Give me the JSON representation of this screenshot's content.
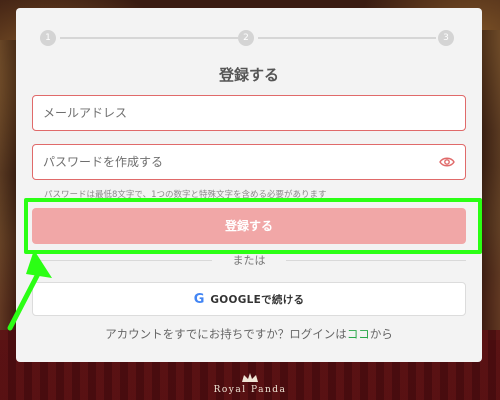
{
  "stepper": {
    "steps": [
      "1",
      "2",
      "3"
    ]
  },
  "form": {
    "title": "登録する",
    "email_placeholder": "メールアドレス",
    "password_placeholder": "パスワードを作成する",
    "password_hint": "パスワードは最低8文字で、1つの数字と特殊文字を含める必要があります",
    "register_label": "登録する",
    "or_text": "または",
    "google_icon_glyph": "G",
    "google_label": "GOOGLEで続ける",
    "login_prompt": "アカウントをすでにお持ちですか？ログインは",
    "login_link": "ココ",
    "login_suffix": "から"
  },
  "logo": {
    "text": "Royal Panda"
  },
  "colors": {
    "accent": "#f1a7a7",
    "field_border": "#e06a6a",
    "highlight": "#2bff14",
    "link": "#2aa84a"
  },
  "icons": {
    "password_toggle": "eye-icon",
    "google": "google-icon",
    "annotation": "arrow-icon",
    "brand": "crown-icon"
  }
}
